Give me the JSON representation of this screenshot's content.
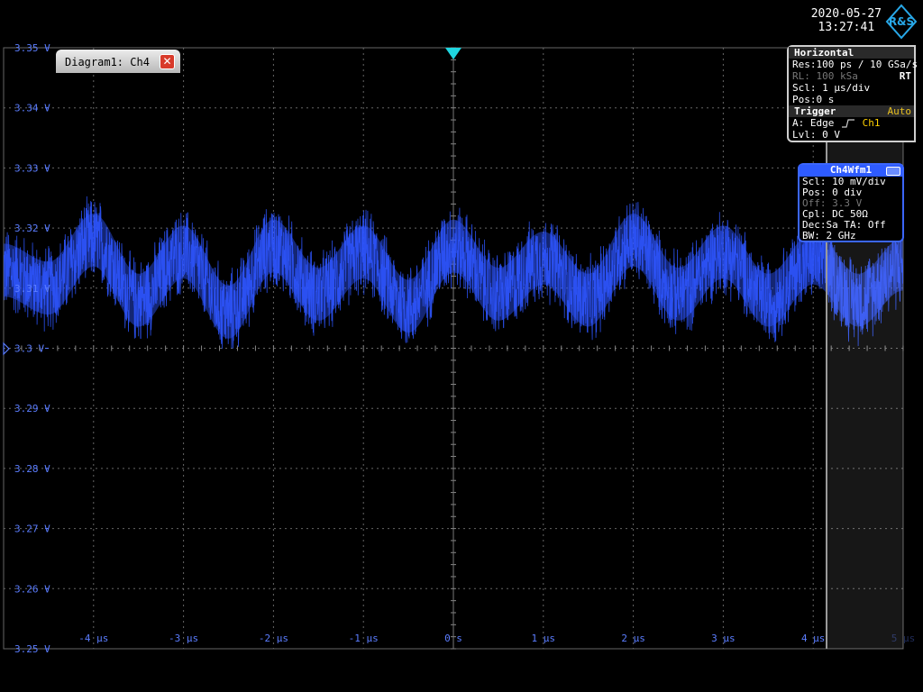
{
  "datetime": {
    "date": "2020-05-27",
    "time": "13:27:41"
  },
  "logo_text": "R&S",
  "diagram_tab": {
    "label": "Diagram1: Ch4",
    "close_icon": "close-icon"
  },
  "horizontal": {
    "title": "Horizontal",
    "res": "Res:100 ps / 10 GSa/s",
    "rl": "RL: 100 kSa",
    "rt": "RT",
    "scl": "Scl: 1 µs/div",
    "pos": "Pos:0 s"
  },
  "trigger": {
    "title": "Trigger",
    "mode": "Auto",
    "source_label": "A:  Edge",
    "source_channel": "Ch1",
    "level": "Lvl: 0 V"
  },
  "wfm_box": {
    "title": "Ch4Wfm1",
    "scl": "Scl: 10 mV/div",
    "pos": "Pos: 0 div",
    "off": "Off: 3.3 V",
    "cpl": "Cpl: DC 50Ω",
    "dec": "Dec:Sa    TA: Off",
    "bw": "BW: 2 GHz"
  },
  "colors": {
    "trace": "#2d55ff",
    "axis_label": "#5b7dff",
    "grid": "#666666",
    "trigger_marker": "#1fd6e0"
  },
  "chart_data": {
    "type": "line",
    "x_ticks": [
      "-4 µs",
      "-3 µs",
      "-2 µs",
      "-1 µs",
      "0 s",
      "1 µs",
      "2 µs",
      "3 µs",
      "4 µs",
      "5 µs"
    ],
    "y_ticks": [
      "3.35 V",
      "3.34 V",
      "3.33 V",
      "3.32 V",
      "3.31 V",
      "3.3 V",
      "3.29 V",
      "3.28 V",
      "3.27 V",
      "3.26 V",
      "3.25 V"
    ],
    "xlim": [
      -5,
      5
    ],
    "ylim": [
      3.25,
      3.35
    ],
    "x_unit": "µs",
    "y_unit": "V",
    "grid": true,
    "series": [
      {
        "x": [
          -5.0,
          -4.5,
          -4.0,
          -3.5,
          -3.0,
          -2.5,
          -2.0,
          -1.5,
          -1.0,
          -0.5,
          0.0,
          0.5,
          1.0,
          1.5,
          2.0,
          2.5,
          3.0,
          3.5,
          4.0,
          4.5,
          5.0
        ],
        "y": [
          3.313,
          3.31,
          3.318,
          3.308,
          3.316,
          3.306,
          3.317,
          3.309,
          3.316,
          3.307,
          3.317,
          3.309,
          3.315,
          3.308,
          3.318,
          3.309,
          3.316,
          3.308,
          3.315,
          3.308,
          3.314
        ],
        "noise_peak_to_peak": 0.016
      }
    ]
  }
}
